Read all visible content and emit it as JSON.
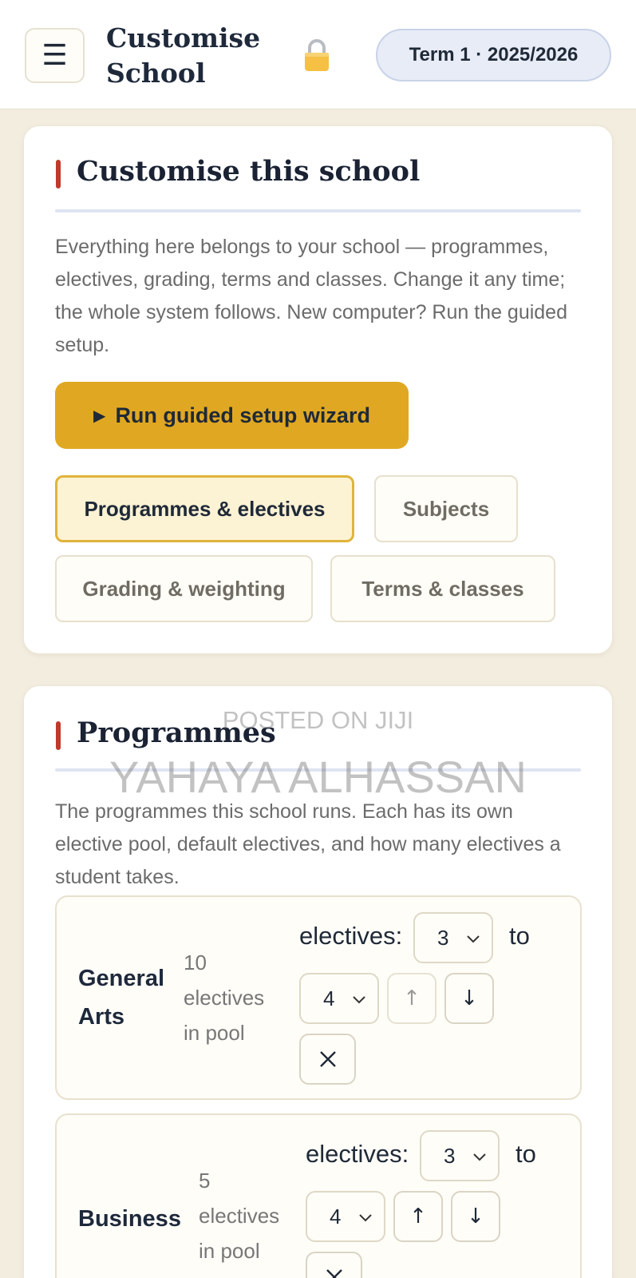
{
  "header": {
    "menu_icon": "menu-icon",
    "title": "Customise School",
    "lock_icon": "lock-icon",
    "term": "Term 1 · 2025/2026"
  },
  "customise": {
    "title": "Customise this school",
    "description": "Everything here belongs to your school — programmes, electives, grading, terms and classes. Change it any time; the whole system follows. New computer? Run the guided setup.",
    "wizard_button": "Run guided setup wizard",
    "wizard_icon": "▶",
    "tabs": [
      {
        "label": "Programmes & electives",
        "active": true
      },
      {
        "label": "Subjects",
        "active": false
      },
      {
        "label": "Grading & weighting",
        "active": false
      },
      {
        "label": "Terms & classes",
        "active": false
      }
    ]
  },
  "programmes": {
    "title": "Programmes",
    "description": "The programmes this school runs. Each has its own elective pool, default electives, and how many electives a student takes.",
    "electives_label": "electives:",
    "to_label": "to",
    "items": [
      {
        "name": "General Arts",
        "pool_count": "10",
        "pool_line1": "electives",
        "pool_line2": "in pool",
        "min": "3",
        "max": "4"
      },
      {
        "name": "Business",
        "pool_count": "5",
        "pool_line1": "electives",
        "pool_line2": "in pool",
        "min": "3",
        "max": "4"
      }
    ]
  },
  "watermark": {
    "line1": "POSTED ON JIJI",
    "line2": "YAHAYA ALHASSAN"
  },
  "colors": {
    "accent": "#e0a822",
    "title_bar": "#c0392b",
    "background": "#f3ede0"
  }
}
